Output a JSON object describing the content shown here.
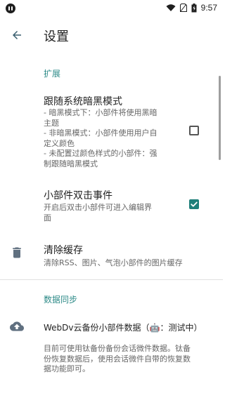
{
  "status_bar": {
    "time": "9:57"
  },
  "header": {
    "title": "设置"
  },
  "sections": {
    "extend": "扩展",
    "sync": "数据同步"
  },
  "prefs": {
    "follow_dark": {
      "title": "跟随系统暗黑模式",
      "summary": "- 暗黑模式下：小部件将使用黑暗\n主题\n- 非暗黑模式：小部件使用用户自\n定义颜色\n- 未配置过颜色样式的小部件：强\n制跟随暗黑模式",
      "checked": false
    },
    "double_tap": {
      "title": "小部件双击事件",
      "summary": "开启后双击小部件可进入编辑界\n面",
      "checked": true
    },
    "clear_cache": {
      "title": "清除缓存",
      "summary": "清除RSS、图片、气泡小部件的图片缓存"
    },
    "webdav": {
      "title": "WebDv云备份小部件数据（🤖：测试中）",
      "summary": "目前可使用钛备份备份会话微件数据。钛备\n份恢复数据后，使用会话微件自带的恢复数\n据功能即可。"
    }
  },
  "colors": {
    "accent": "#2e8b88",
    "checkbox_checked": "#1f7f7a"
  },
  "icons": {
    "back": "arrow-back-icon",
    "trash": "trash-icon",
    "cloud": "cloud-upload-icon"
  }
}
